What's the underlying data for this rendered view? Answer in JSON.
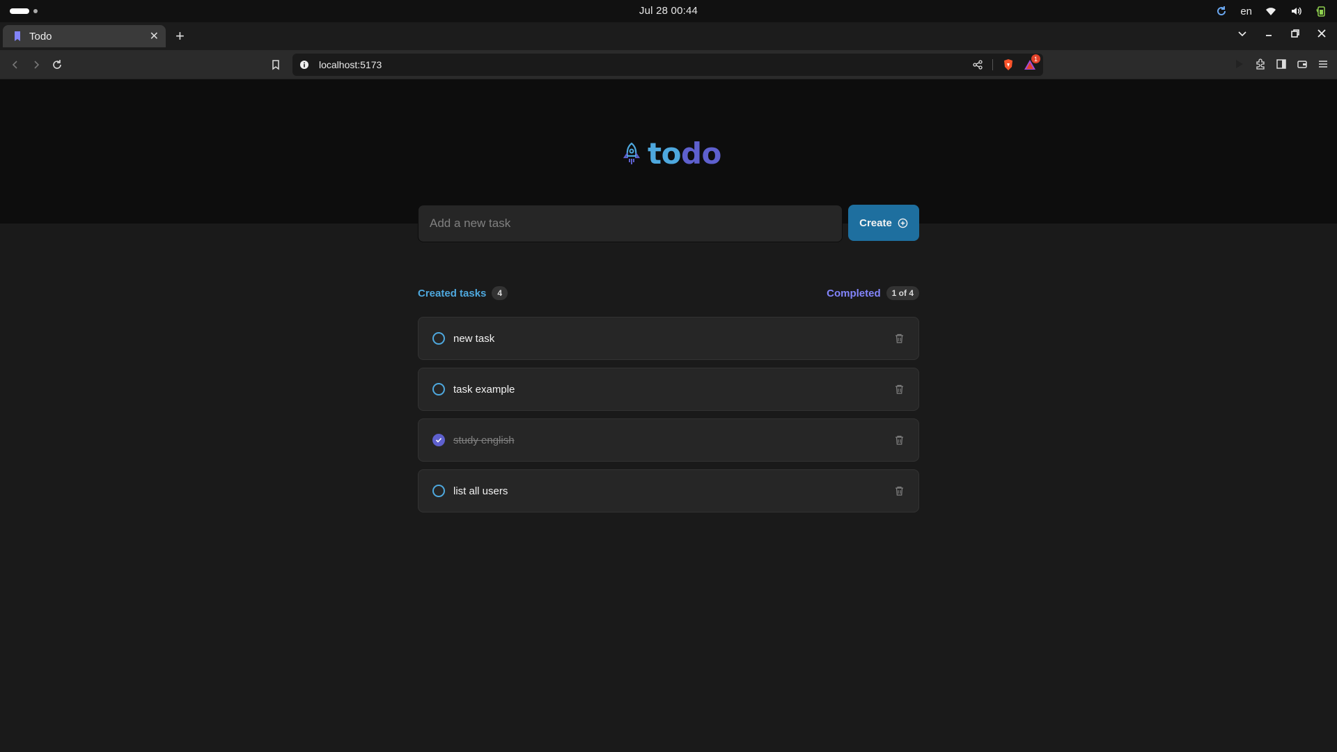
{
  "os": {
    "clock": "Jul 28  00:44",
    "language": "en",
    "icons": [
      "refresh-icon",
      "wifi-icon",
      "volume-icon",
      "battery-icon"
    ]
  },
  "browser": {
    "tab_title": "Todo",
    "url": "localhost:5173",
    "alert_count": "1"
  },
  "app": {
    "logo_part1": "to",
    "logo_part2": "do",
    "input_placeholder": "Add a new task",
    "create_label": "Create",
    "created_label": "Created tasks",
    "created_count": "4",
    "completed_label": "Completed",
    "completed_count": "1 of 4",
    "colors": {
      "blue": "#4ea8de",
      "purple": "#5e60ce",
      "button": "#1e6f9f"
    }
  },
  "tasks": [
    {
      "label": "new task",
      "done": false
    },
    {
      "label": "task example",
      "done": false
    },
    {
      "label": "study english",
      "done": true
    },
    {
      "label": "list all users",
      "done": false
    }
  ]
}
